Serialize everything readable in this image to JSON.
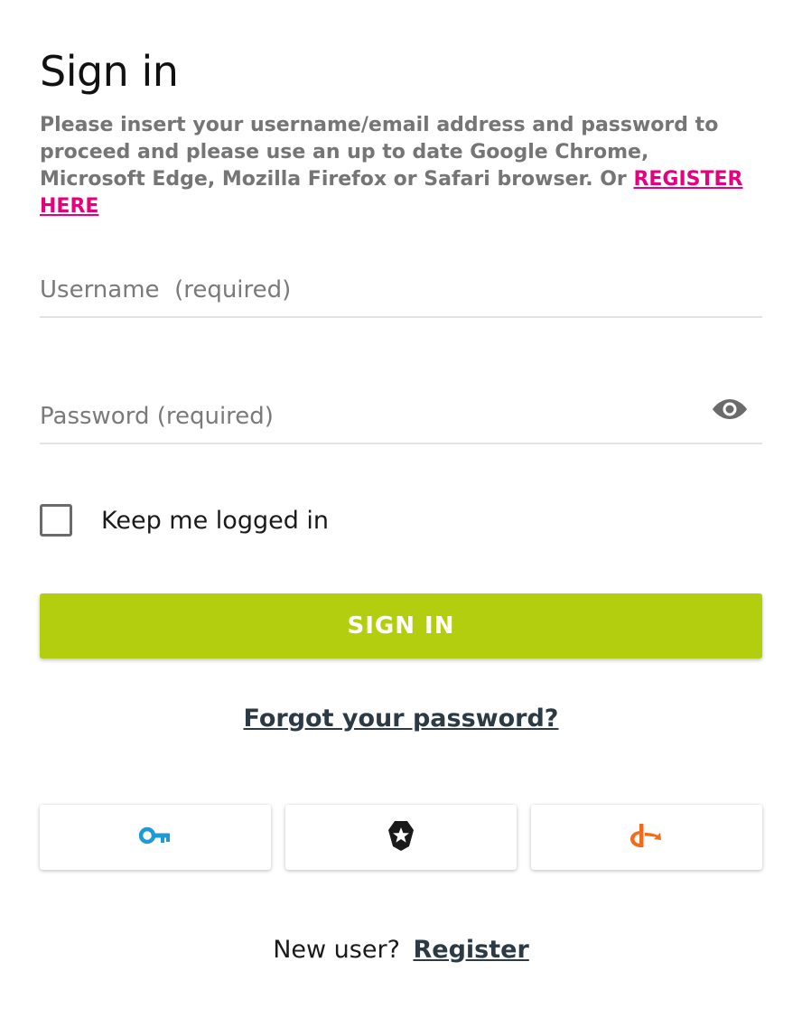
{
  "heading": {
    "title": "Sign in"
  },
  "intro": {
    "text": "Please insert your username/email address and password to proceed and please use an up to date Google Chrome, Microsoft Edge, Mozilla Firefox or Safari browser. Or ",
    "register_link": "REGISTER HERE"
  },
  "form": {
    "username_placeholder": "Username  (required)",
    "username_value": "",
    "password_placeholder": "Password (required)",
    "password_value": "",
    "keep_logged_in_label": "Keep me logged in",
    "keep_logged_in_checked": false,
    "sign_in_label": "SIGN IN",
    "forgot_password_label": "Forgot your password?"
  },
  "sso": {
    "buttons": [
      {
        "icon": "key-icon",
        "color": "#1e9ad6"
      },
      {
        "icon": "auth0-shield-icon",
        "color": "#1a1a1a"
      },
      {
        "icon": "openid-icon",
        "color": "#f26b1d"
      }
    ]
  },
  "footer": {
    "new_user_text": "New user?",
    "register_label": "Register"
  },
  "colors": {
    "accent_green": "#b2ce0e",
    "link_pink": "#e6007e",
    "link_dark": "#2b3a44"
  }
}
